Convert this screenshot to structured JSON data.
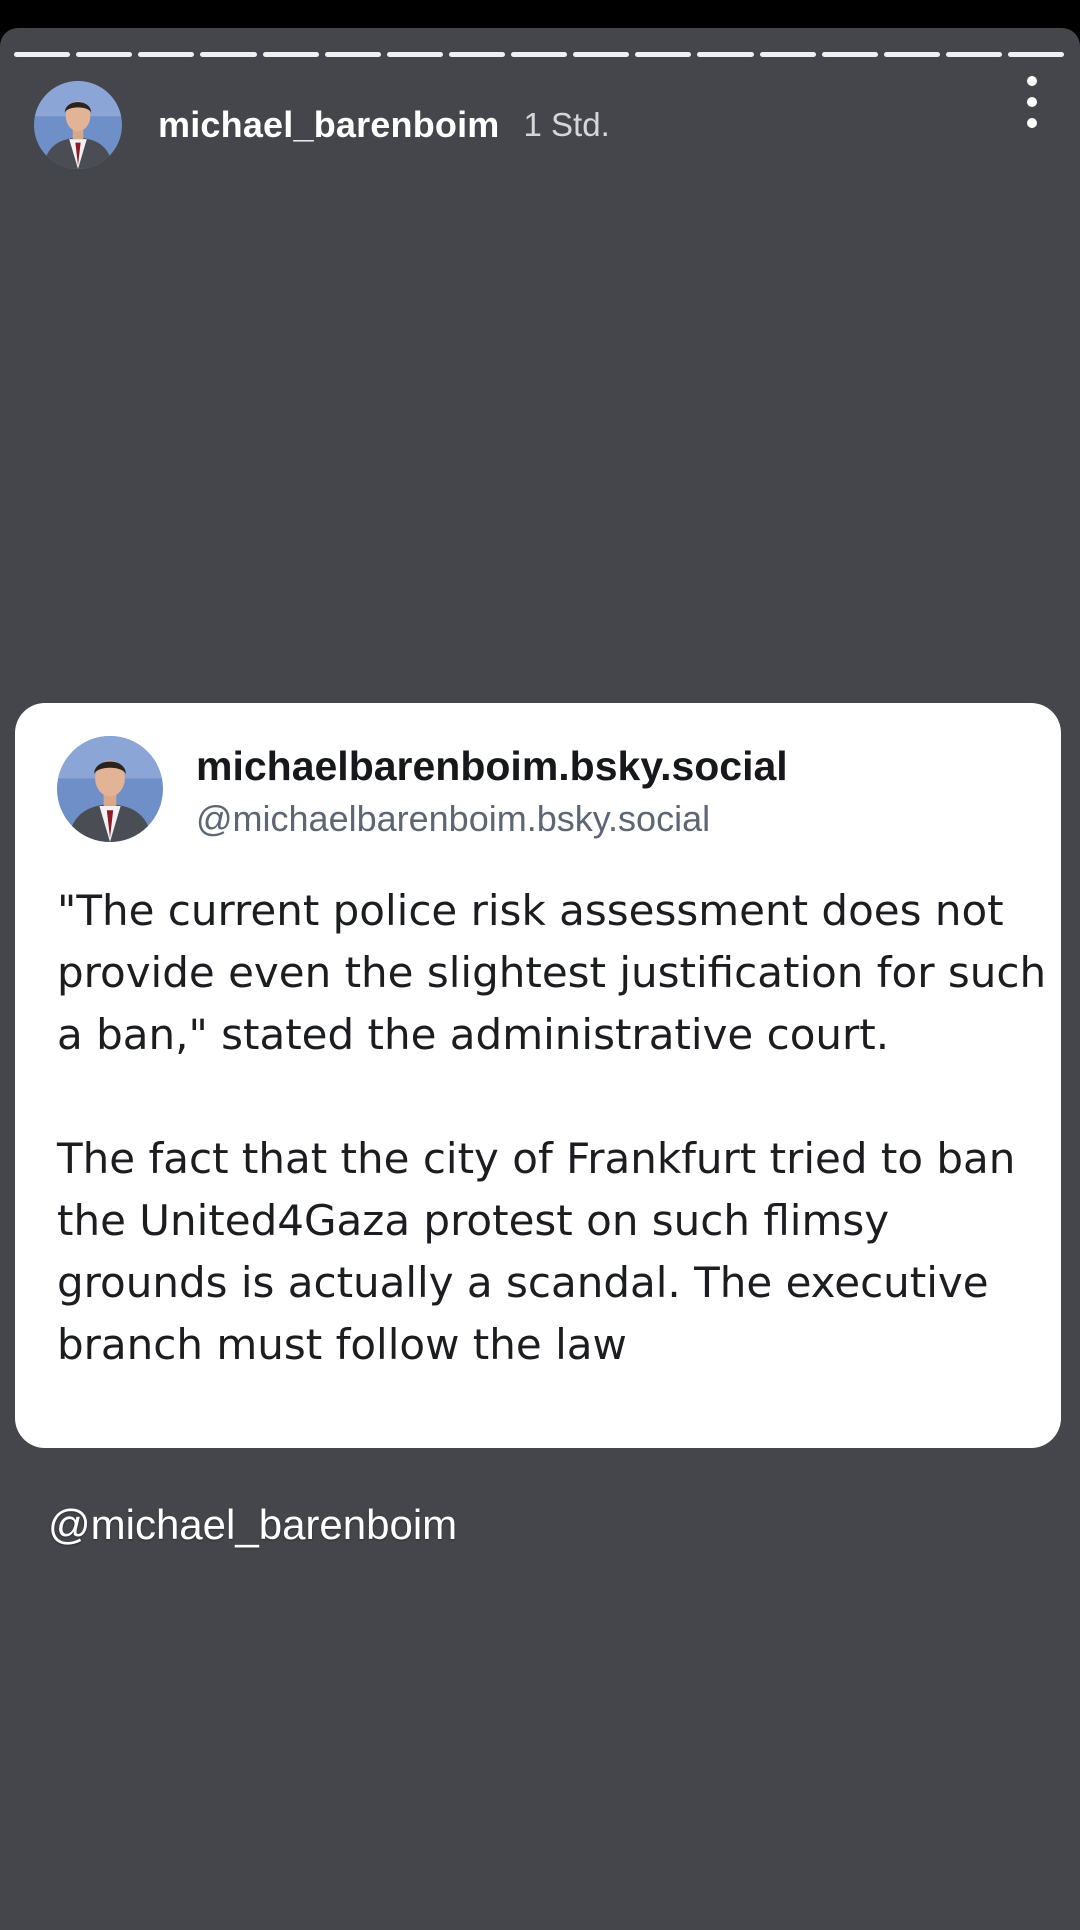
{
  "story": {
    "progress_segments": 17,
    "username": "michael_barenboim",
    "timestamp": "1 Std.",
    "menu_icon": "more-vertical-icon",
    "mention": "@michael_barenboim"
  },
  "post": {
    "display_name": "michaelbarenboim.bsky.social",
    "handle": "@michaelbarenboim.bsky.social",
    "paragraphs": [
      "\"The current police risk assessment does not provide even the slightest justification for such a ban,\" stated the administrative court.",
      "The fact that the city of Frankfurt tried to ban the United4Gaza protest on such flimsy grounds is actually a scandal. The executive branch must follow the law"
    ]
  },
  "colors": {
    "story_background": "#45464b",
    "card_background": "#ffffff",
    "text_primary": "#ffffff"
  }
}
